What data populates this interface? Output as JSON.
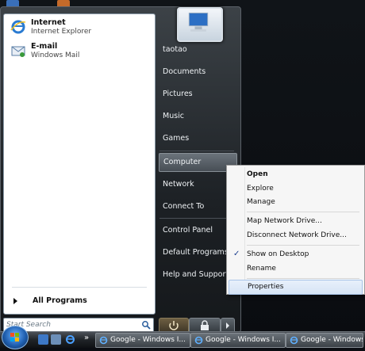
{
  "start_menu": {
    "pinned": [
      {
        "title": "Internet",
        "subtitle": "Internet Explorer",
        "icon": "internet-explorer-icon"
      },
      {
        "title": "E-mail",
        "subtitle": "Windows Mail",
        "icon": "windows-mail-icon"
      }
    ],
    "all_programs_label": "All Programs",
    "search_placeholder": "Start Search",
    "right_items": [
      "taotao",
      "Documents",
      "Pictures",
      "Music",
      "Games",
      "Computer",
      "Network",
      "Connect To",
      "Control Panel",
      "Default Programs",
      "Help and Support"
    ]
  },
  "context_menu": {
    "items": [
      {
        "label": "Open",
        "bold": true
      },
      {
        "label": "Explore"
      },
      {
        "label": "Manage"
      },
      {
        "label": "Map Network Drive..."
      },
      {
        "label": "Disconnect Network Drive..."
      },
      {
        "label": "Show on Desktop",
        "checked": true
      },
      {
        "label": "Rename"
      },
      {
        "label": "Properties"
      }
    ]
  },
  "taskbar": {
    "quick_launch_more": "»",
    "task_buttons": [
      "Google - Windows I...",
      "Google - Windows I...",
      "Google - Windows I..."
    ]
  }
}
